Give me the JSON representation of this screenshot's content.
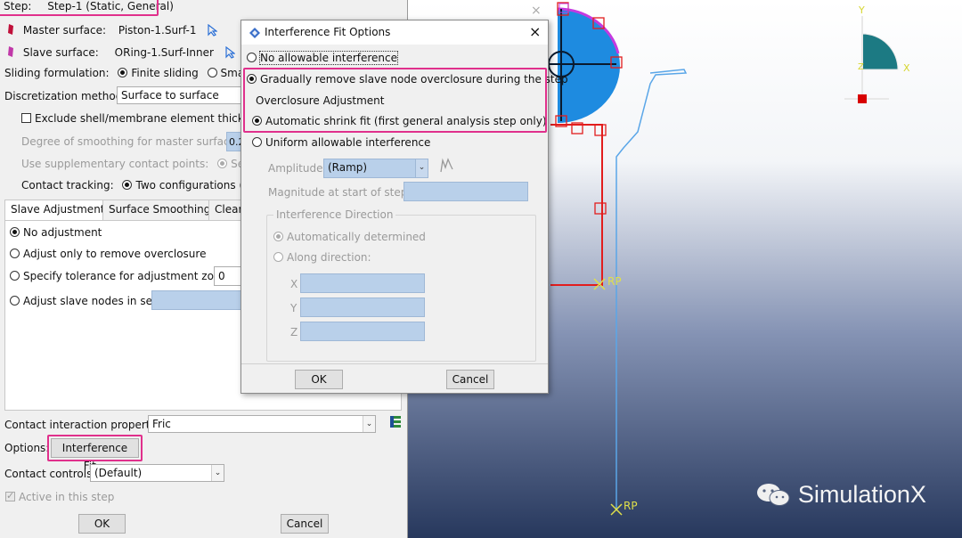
{
  "editor": {
    "step_label": "Step:",
    "step_value": "Step-1 (Static, General)",
    "master_label": "Master surface:",
    "master_value": "Piston-1.Surf-1",
    "slave_label": "Slave surface:",
    "slave_value": "ORing-1.Surf-Inner",
    "sliding_label": "Sliding formulation:",
    "sliding_finite": "Finite sliding",
    "sliding_small": "Small sl",
    "discretization_label": "Discretization method:",
    "discretization_value": "Surface to surface",
    "exclude_shell": "Exclude shell/membrane element thicknes",
    "degree_smoothing": "Degree of smoothing for master surface:",
    "degree_smoothing_value": "0.2",
    "supplementary_label": "Use supplementary contact points:",
    "supplementary_option": "Select",
    "tracking_label": "Contact tracking:",
    "tracking_option": "Two configurations (pat",
    "tabs": [
      "Slave Adjustment",
      "Surface Smoothing",
      "Clear"
    ],
    "no_adjustment": "No adjustment",
    "adjust_only": "Adjust only to remove overclosure",
    "specify_tolerance": "Specify tolerance for adjustment zone:",
    "specify_tolerance_value": "0",
    "adjust_slave_nodes": "Adjust slave nodes in set:",
    "property_label": "Contact interaction property:",
    "property_value": "Fric",
    "options_label": "Options:",
    "interference_button": "Interference Fit...",
    "controls_label": "Contact controls:",
    "controls_value": "(Default)",
    "active_label": "Active in this step",
    "ok": "OK",
    "cancel": "Cancel"
  },
  "dialog": {
    "title": "Interference Fit Options",
    "close": "×",
    "no_interference": "No allowable interference",
    "gradually_remove": "Gradually remove slave node overclosure during the step",
    "overclosure_heading": "Overclosure Adjustment",
    "automatic_shrink": "Automatic shrink fit (first general analysis step only)",
    "uniform": "Uniform allowable interference",
    "amplitude_label": "Amplitude:",
    "amplitude_value": "(Ramp)",
    "magnitude_label": "Magnitude at start of step:",
    "direction_heading": "Interference Direction",
    "auto_determined": "Automatically determined",
    "along_direction": "Along direction:",
    "x_label": "X",
    "y_label": "Y",
    "z_label": "Z",
    "ok": "OK",
    "cancel": "Cancel"
  },
  "viewport": {
    "rp_label_1": "RP",
    "rp_label_2": "RP",
    "triad_y": "Y",
    "triad_x": "X",
    "triad_z": "Z",
    "watermark": "SimulationX",
    "close_glyph": "×"
  },
  "colors": {
    "highlight": "#e0308c",
    "part_blue": "#1e8be0",
    "constraint_red": "#e21d1d",
    "outline_blue": "#5aa6e8",
    "triad_teal": "#1c7a83"
  }
}
